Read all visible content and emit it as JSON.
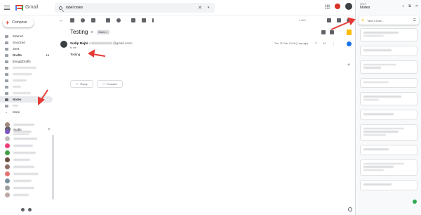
{
  "app": {
    "name": "Gmail"
  },
  "search": {
    "value": "label:notes",
    "clear": "✕",
    "options": "▾"
  },
  "compose": {
    "label": "Compose"
  },
  "nav": [
    {
      "label": "Starred"
    },
    {
      "label": "Snoozed"
    },
    {
      "label": "Sent"
    },
    {
      "label": "Drafts",
      "count": "14"
    },
    {
      "label": "[Imap]/Drafts"
    },
    {
      "label": ""
    },
    {
      "label": ""
    },
    {
      "label": ""
    },
    {
      "label": ""
    },
    {
      "label": ""
    },
    {
      "label": "Notes"
    },
    {
      "label": ""
    },
    {
      "label": "More"
    }
  ],
  "hangouts": {
    "user": "Sudip",
    "status": ""
  },
  "pager": "1 of 1",
  "message": {
    "subject": "Testing",
    "label_chip": "Notes ×",
    "sender": "Sudip Majhi",
    "email_start": "<",
    "email_end": "@gmail.com>",
    "to": "to me",
    "date": "Thu, 21 Feb, 14:29 (1 day ago)",
    "body": "Testing",
    "reply_label": "Reply",
    "forward_label": "Forward"
  },
  "keep": {
    "app_label": "KEEP",
    "title": "Notes",
    "placeholder": "Take a note..."
  },
  "colors": {
    "accent": "#1a73e8",
    "brand_red": "#ea4335",
    "keep_yellow": "#fbbc04",
    "arrow": "#e53935"
  },
  "icons": [
    "menu-icon",
    "search-icon",
    "apps-icon",
    "back-icon",
    "archive-icon",
    "spam-icon",
    "delete-icon",
    "print-icon",
    "keep-icon",
    "tasks-icon"
  ]
}
